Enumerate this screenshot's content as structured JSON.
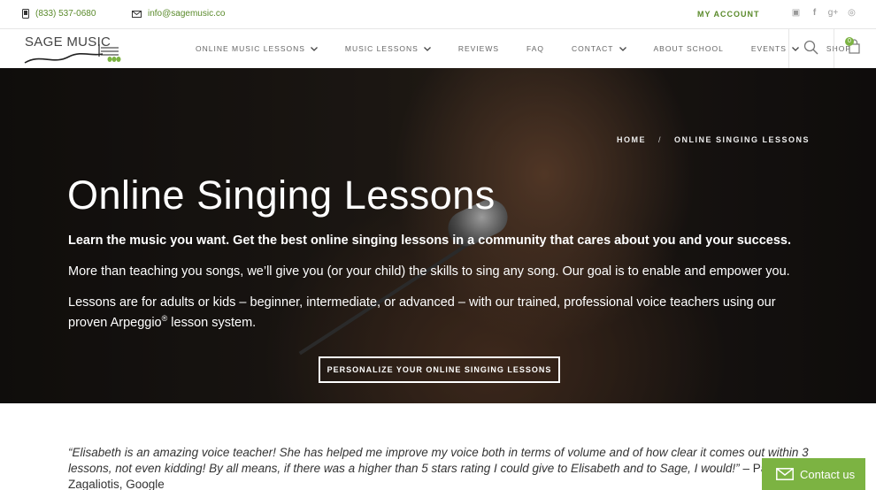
{
  "topbar": {
    "phone": "(833) 537-0680",
    "email": "info@sagemusic.co",
    "account": "MY ACCOUNT",
    "social": [
      "youtube-icon",
      "facebook-icon",
      "google-plus-icon",
      "instagram-icon"
    ]
  },
  "logo": {
    "text": "SAGE MUSIC"
  },
  "nav": {
    "items": [
      {
        "label": "ONLINE MUSIC LESSONS",
        "dropdown": true
      },
      {
        "label": "MUSIC LESSONS",
        "dropdown": true
      },
      {
        "label": "REVIEWS",
        "dropdown": false
      },
      {
        "label": "FAQ",
        "dropdown": false
      },
      {
        "label": "CONTACT",
        "dropdown": true
      },
      {
        "label": "ABOUT SCHOOL",
        "dropdown": false
      },
      {
        "label": "EVENTS",
        "dropdown": true
      },
      {
        "label": "SHOP",
        "dropdown": false
      }
    ],
    "cart_count": "0"
  },
  "hero": {
    "breadcrumb": {
      "home": "HOME",
      "separator": "/",
      "current": "ONLINE SINGING LESSONS"
    },
    "title": "Online Singing Lessons",
    "p1": "Learn the music you want. Get the best online singing lessons in a community that cares about you and your success.",
    "p2": "More than teaching you songs, we’ll give you (or your child) the skills to sing any song. Our goal is to enable and empower you.",
    "p3_before": "Lessons are for adults or kids – beginner, intermediate, or advanced – with our trained, professional voice teachers using our proven Arpeggio",
    "p3_sup": "®",
    "p3_after": " lesson system.",
    "cta": "PERSONALIZE YOUR ONLINE SINGING LESSONS"
  },
  "testimonial": {
    "quote": "“Elisabeth is an amazing voice teacher! She has helped me improve my voice both in terms of volume and of how clear it comes out within 3 lessons, not even kidding! By all means, if there was a higher than 5 stars rating I could give to Elisabeth and to Sage, I would!”",
    "author": " – Panagiotis Zagaliotis, Google"
  },
  "contact_button": "Contact us",
  "colors": {
    "accent": "#7cb342",
    "topbar_text": "#5a8a2b"
  }
}
